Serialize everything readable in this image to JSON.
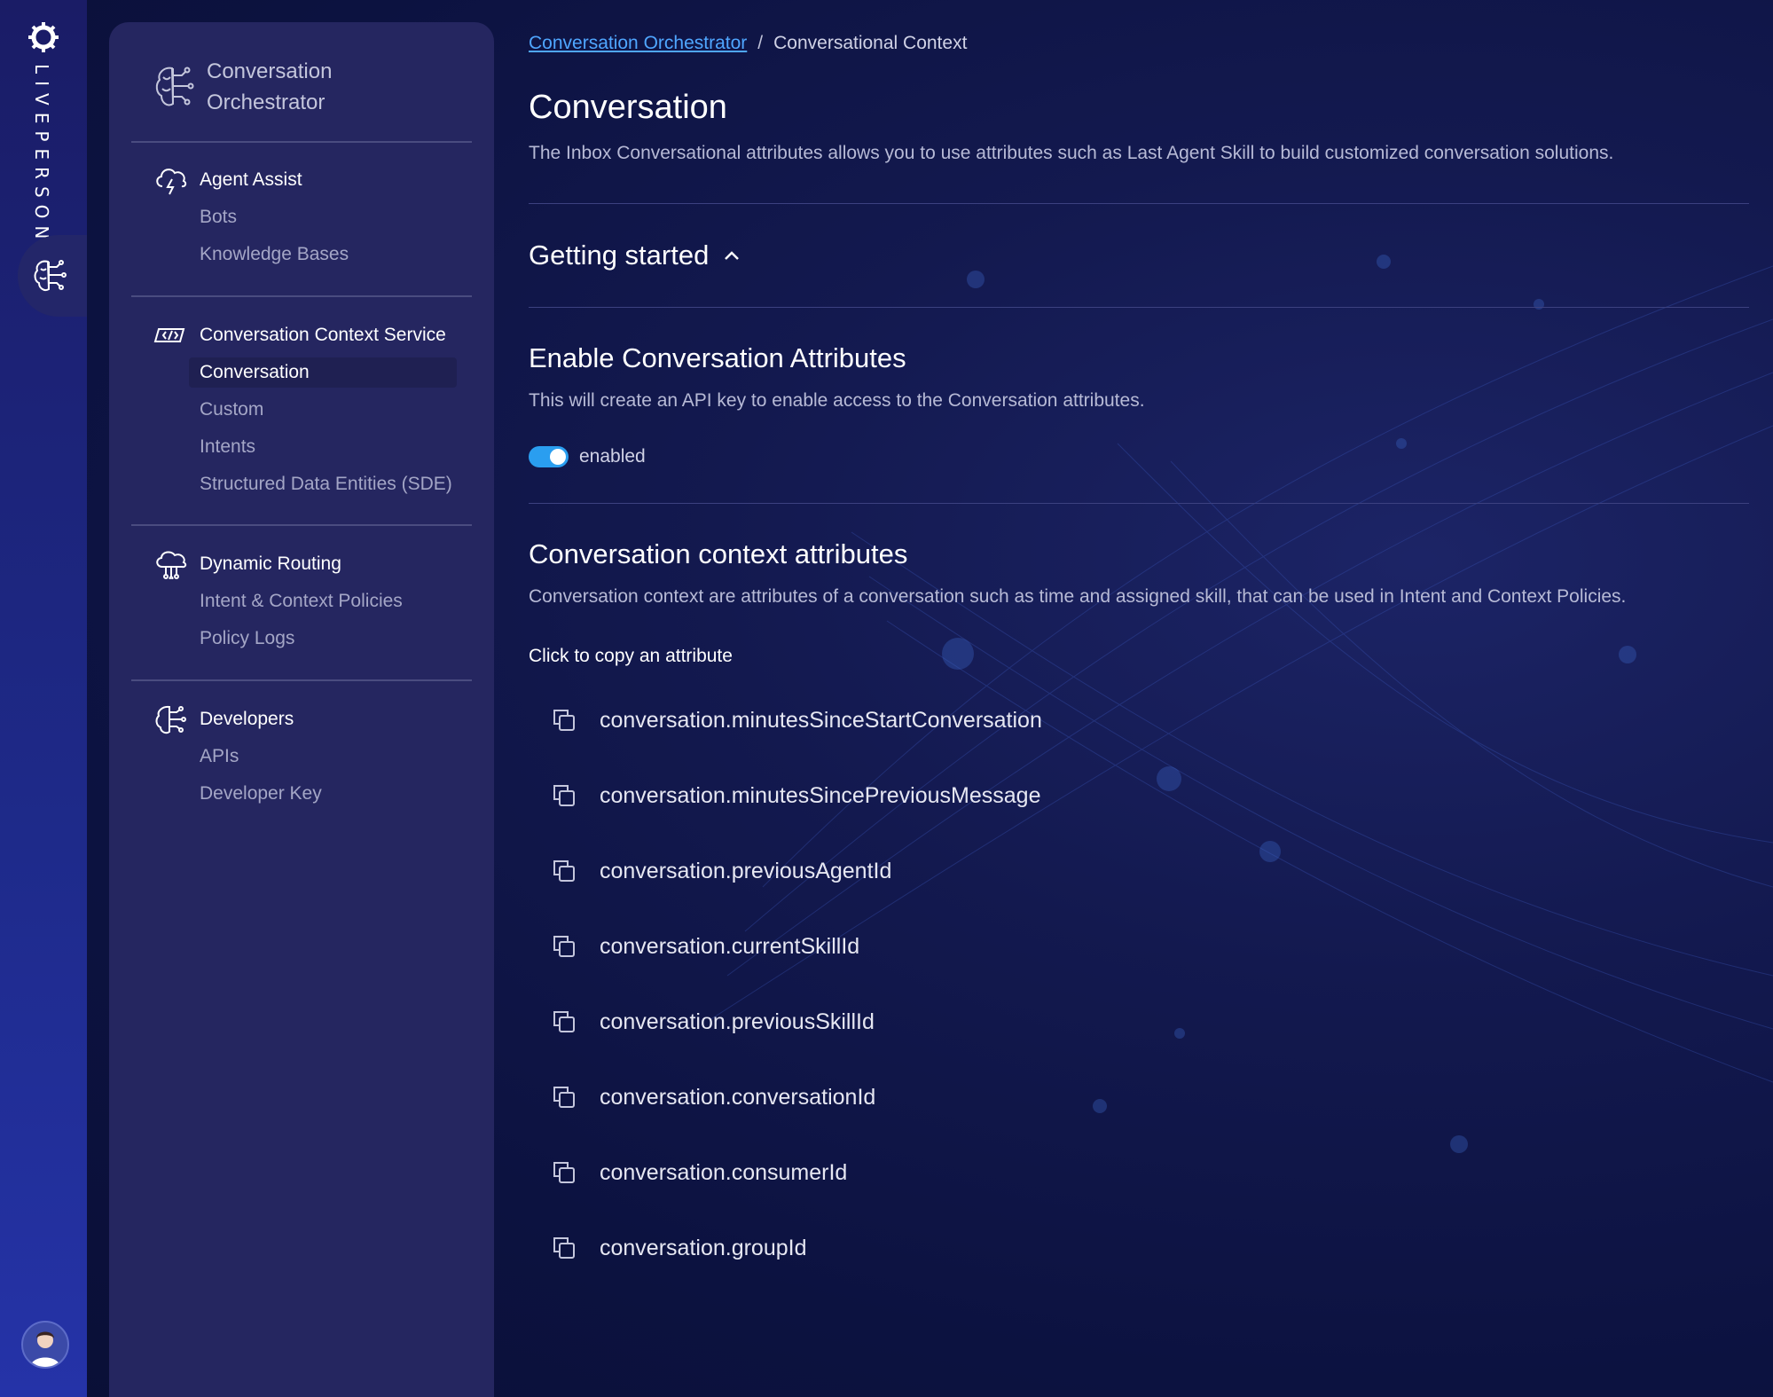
{
  "rail": {
    "brand": "LIVEPERSON"
  },
  "panel": {
    "title": "Conversation Orchestrator",
    "groups": [
      {
        "label": "Agent Assist",
        "icon": "cloud-bolt-icon",
        "items": [
          {
            "label": "Bots",
            "active": false
          },
          {
            "label": "Knowledge Bases",
            "active": false
          }
        ]
      },
      {
        "label": "Conversation Context Service",
        "icon": "code-cloud-icon",
        "items": [
          {
            "label": "Conversation",
            "active": true
          },
          {
            "label": "Custom",
            "active": false
          },
          {
            "label": "Intents",
            "active": false
          },
          {
            "label": "Structured Data Entities (SDE)",
            "active": false
          }
        ]
      },
      {
        "label": "Dynamic Routing",
        "icon": "cloud-network-icon",
        "items": [
          {
            "label": "Intent & Context Policies",
            "active": false
          },
          {
            "label": "Policy Logs",
            "active": false
          }
        ]
      },
      {
        "label": "Developers",
        "icon": "brain-circuit-icon",
        "items": [
          {
            "label": "APIs",
            "active": false
          },
          {
            "label": "Developer Key",
            "active": false
          }
        ]
      }
    ]
  },
  "breadcrumb": {
    "parent": "Conversation Orchestrator",
    "separator": "/",
    "current": "Conversational Context"
  },
  "page": {
    "title": "Conversation",
    "description": "The Inbox Conversational attributes allows you to use attributes such as Last Agent Skill to build customized conversation solutions."
  },
  "getting_started": {
    "label": "Getting started",
    "expanded": true
  },
  "enable_section": {
    "title": "Enable Conversation Attributes",
    "description": "This will create an API key to enable access to the Conversation attributes.",
    "toggle_state": "enabled",
    "toggle_on": true
  },
  "context_section": {
    "title": "Conversation context attributes",
    "description": "Conversation context are attributes of a conversation such as time and assigned skill, that can be used in Intent and Context Policies.",
    "copy_hint": "Click to copy an attribute",
    "attributes": [
      "conversation.minutesSinceStartConversation",
      "conversation.minutesSincePreviousMessage",
      "conversation.previousAgentId",
      "conversation.currentSkillId",
      "conversation.previousSkillId",
      "conversation.conversationId",
      "conversation.consumerId",
      "conversation.groupId"
    ]
  },
  "colors": {
    "accent": "#4fa6ff",
    "toggle": "#2a9ef0",
    "panel": "#252660",
    "rail": "#1e2a8a"
  }
}
